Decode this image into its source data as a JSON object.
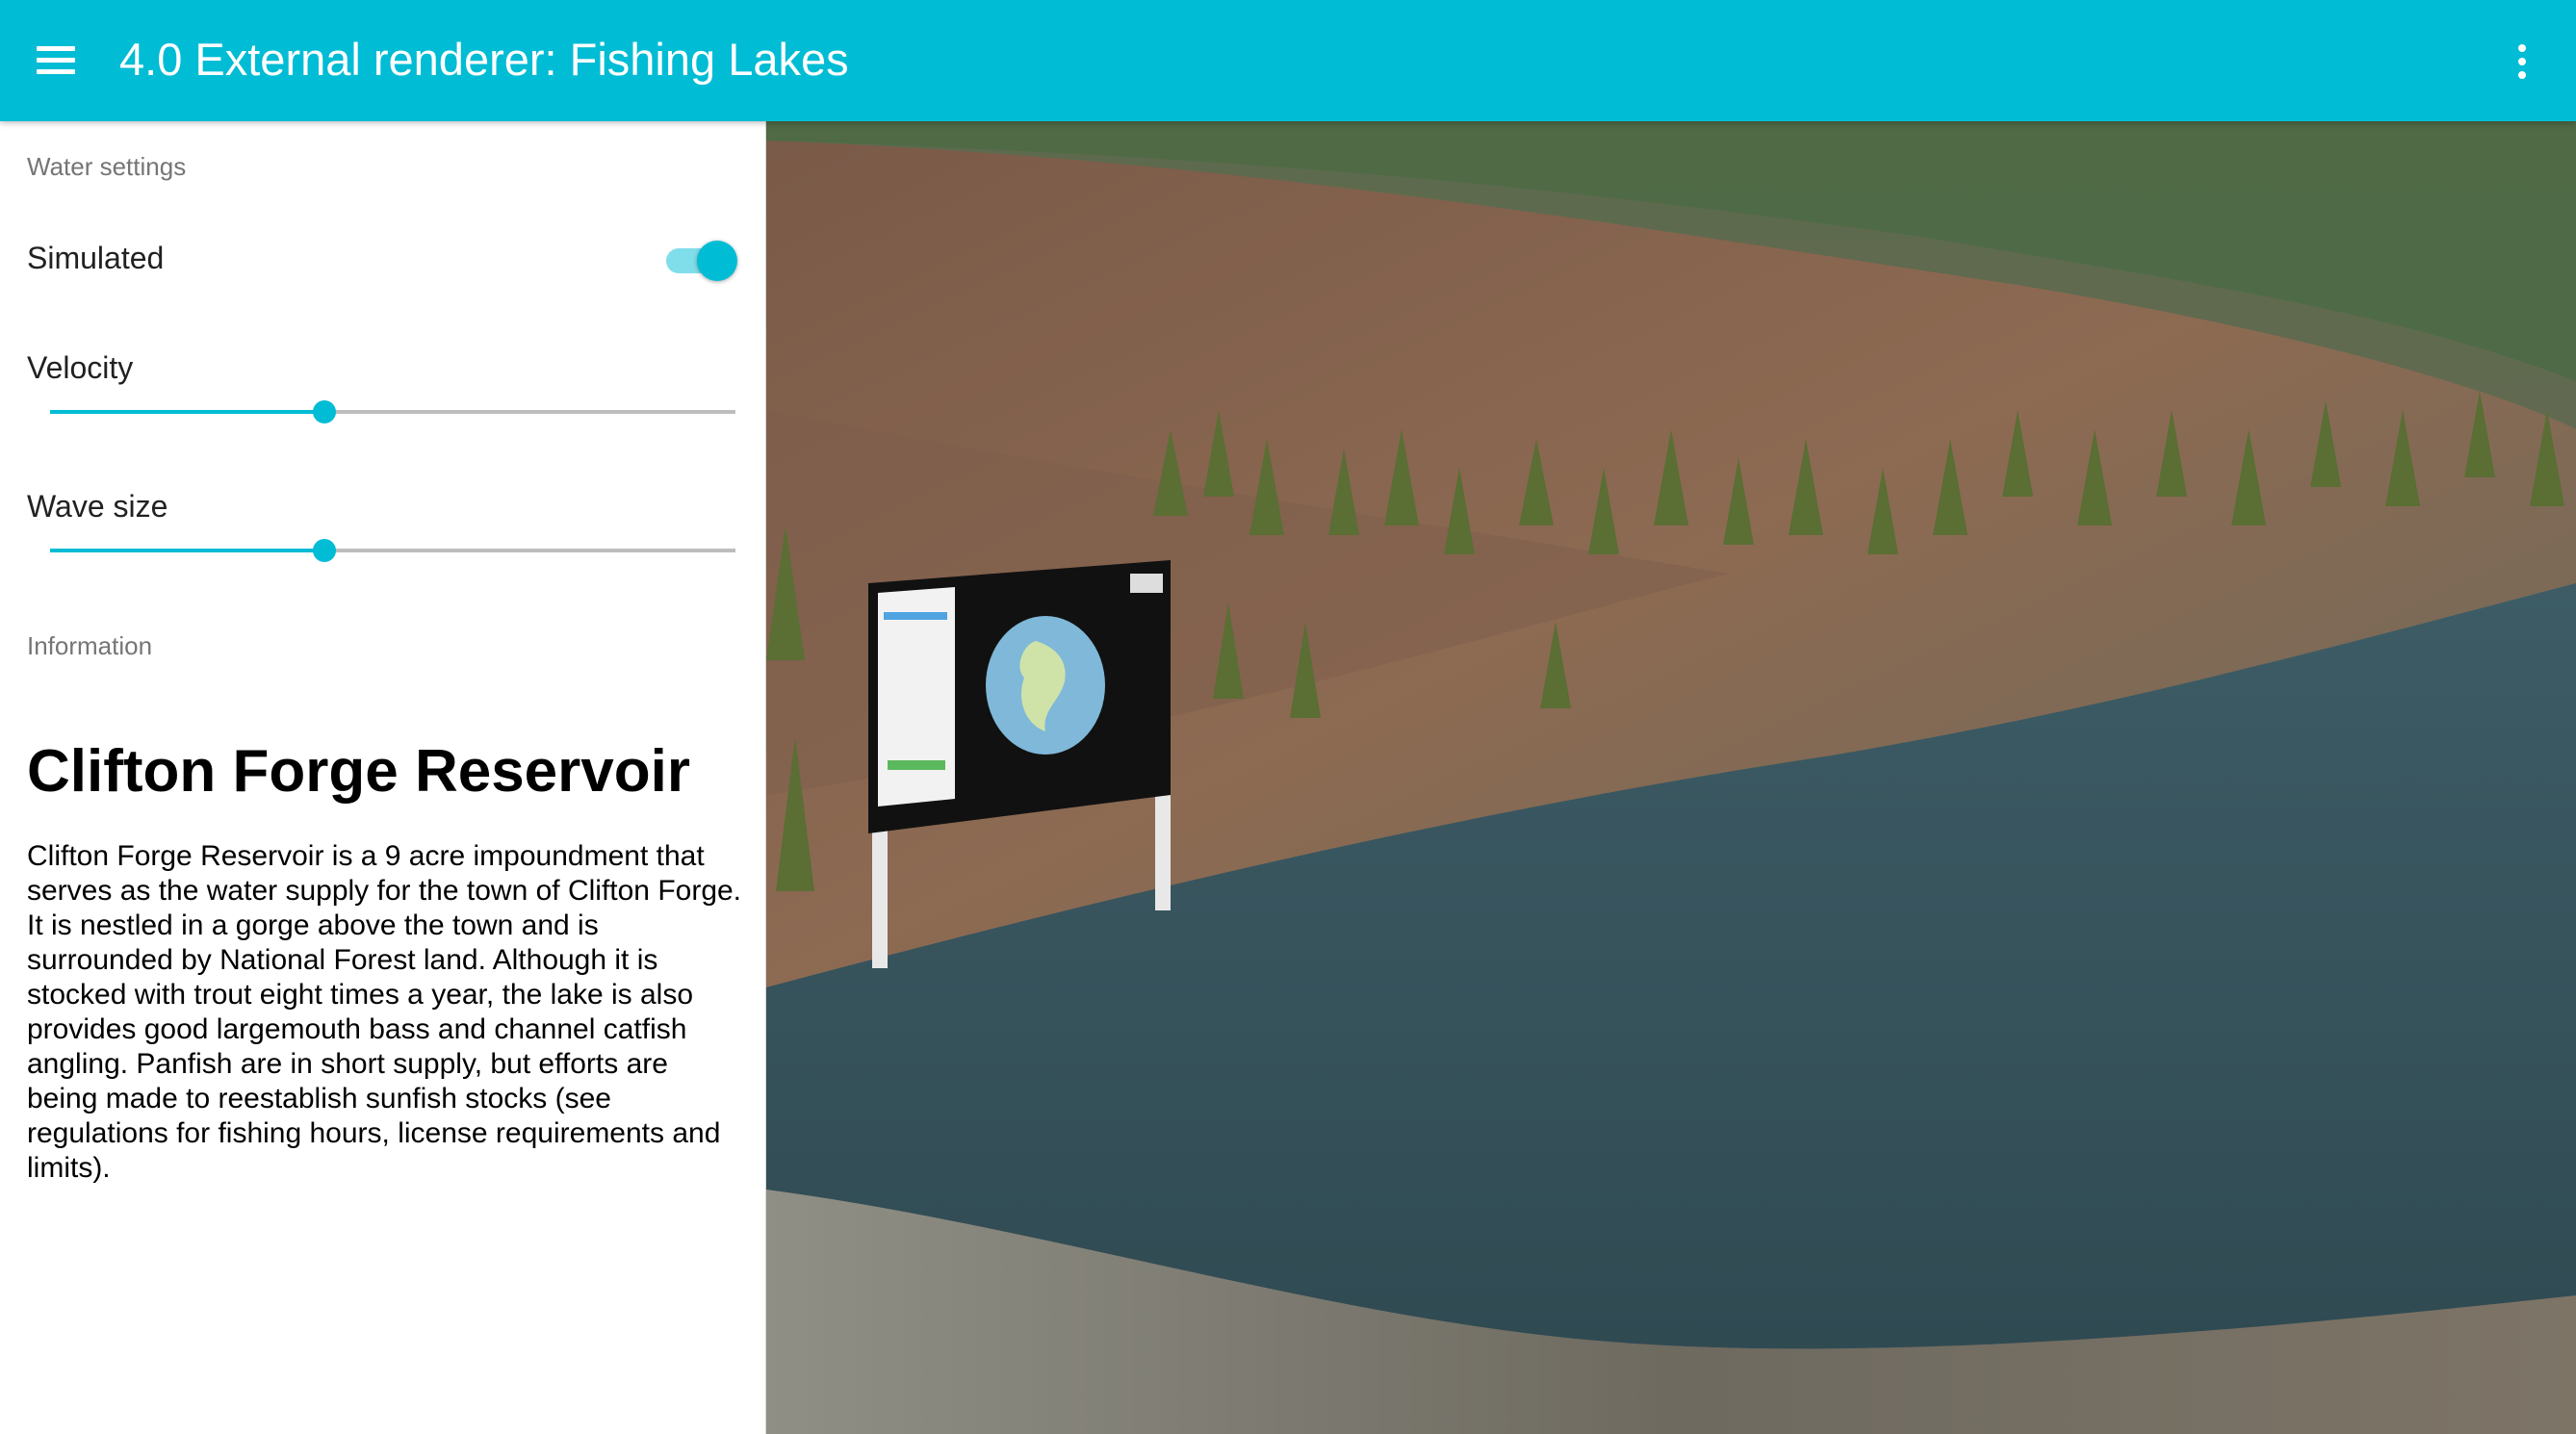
{
  "app": {
    "title": "4.0 External renderer: Fishing Lakes",
    "menu_icon": "menu-icon",
    "more_icon": "more-vert-icon",
    "accent_color": "#00bcd4"
  },
  "sidebar": {
    "water_settings": {
      "header": "Water settings",
      "simulated": {
        "label": "Simulated",
        "on": true
      },
      "velocity": {
        "label": "Velocity",
        "value": 0.4
      },
      "wave_size": {
        "label": "Wave size",
        "value": 0.4
      }
    },
    "information": {
      "header": "Information",
      "title": "Clifton Forge Reservoir",
      "body": "Clifton Forge Reservoir is a 9 acre impoundment that serves as the water supply for the town of Clifton Forge. It is nestled in a gorge above the town and is surrounded by National Forest land. Although it is stocked with trout eight times a year, the lake is also provides good largemouth bass and channel catfish angling. Panfish are in short supply, but efforts are being made to reestablish sunfish stocks (see regulations for fishing hours, license requirements and limits)."
    }
  },
  "scene": {
    "description_icon": "3d-scene-view",
    "water_color": "#3a5a63",
    "terrain_color": "#8a6a55"
  }
}
